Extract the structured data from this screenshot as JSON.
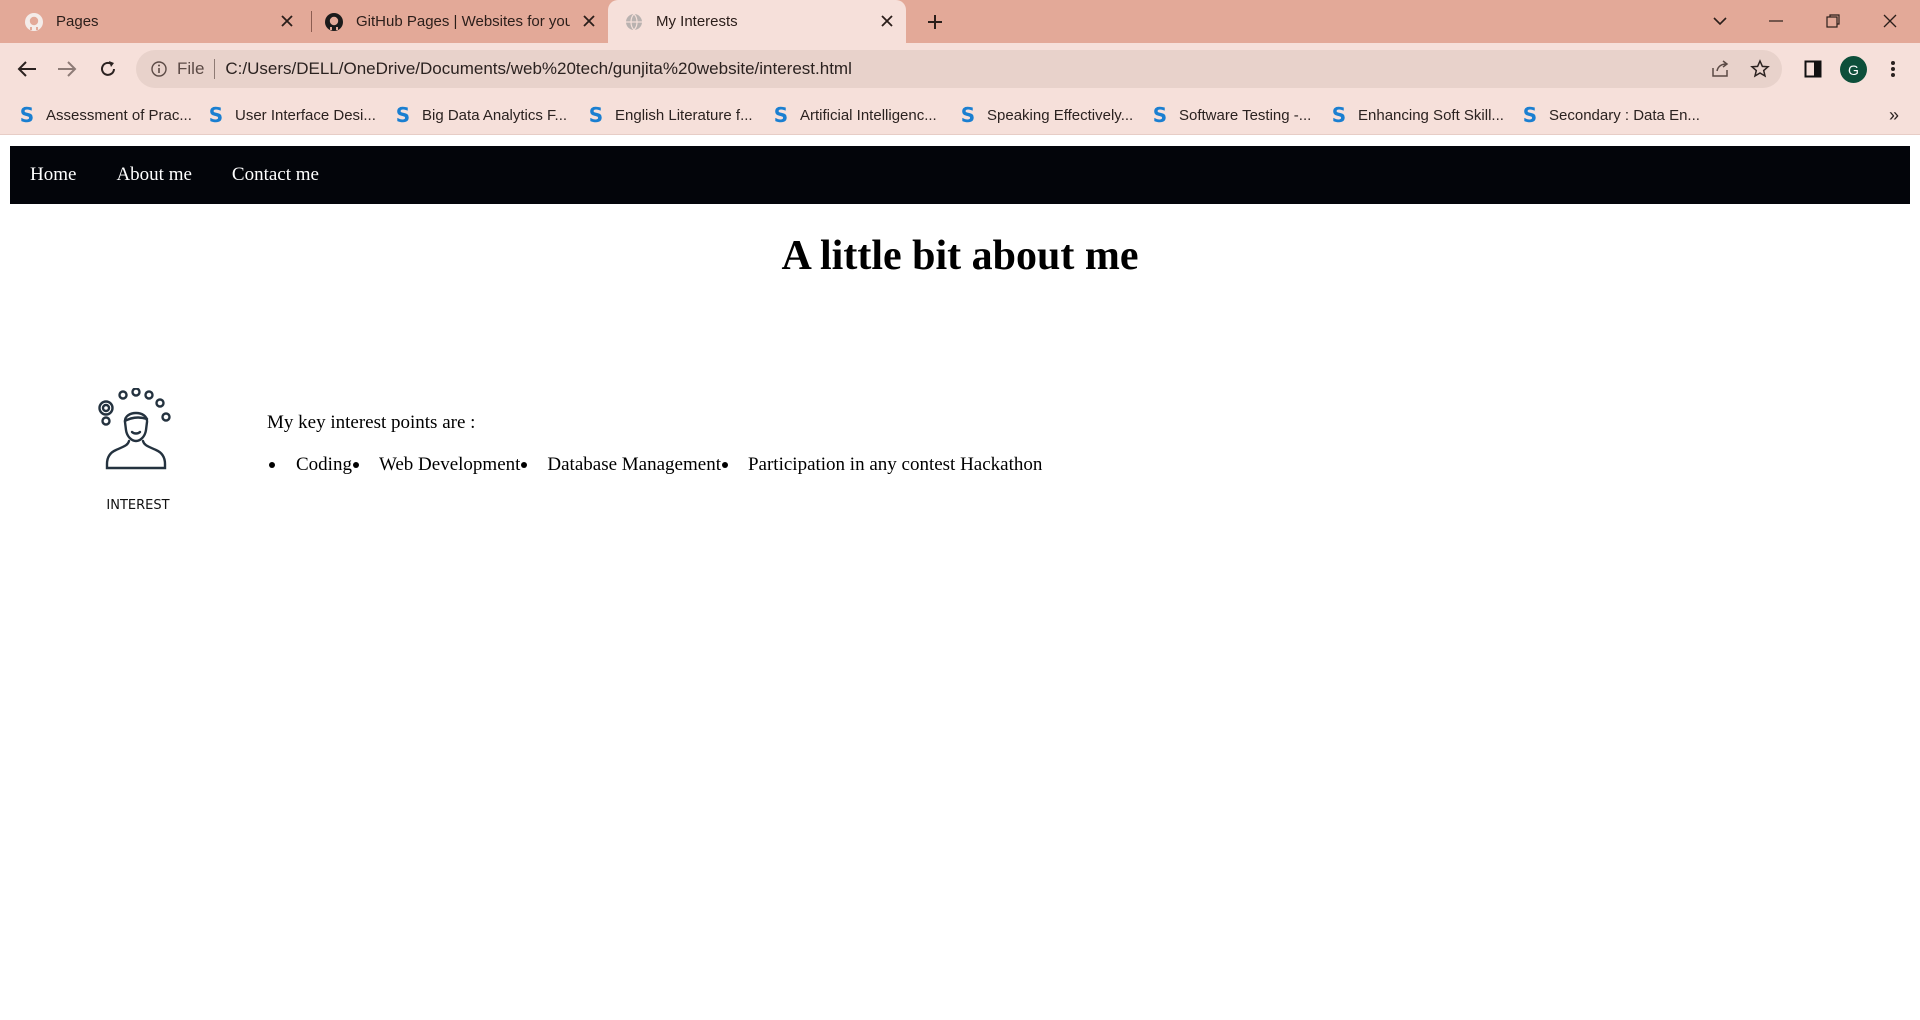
{
  "browser": {
    "tabs": [
      {
        "title": "Pages",
        "icon": "github-icon",
        "active": false
      },
      {
        "title": "GitHub Pages | Websites for you",
        "icon": "github-icon",
        "active": false
      },
      {
        "title": "My Interests",
        "icon": "globe-icon",
        "active": true
      }
    ],
    "address": {
      "scheme_label": "File",
      "url": "C:/Users/DELL/OneDrive/Documents/web%20tech/gunjita%20website/interest.html"
    },
    "profile_initial": "G",
    "bookmarks": [
      "Assessment of Prac...",
      "User Interface Desi...",
      "Big Data Analytics F...",
      "English Literature f...",
      "Artificial Intelligenc...",
      "Speaking Effectively...",
      "Software Testing -...",
      "Enhancing Soft Skill...",
      "Secondary : Data En..."
    ],
    "bookmark_icon_letter": "S",
    "more_bookmarks": "»"
  },
  "site": {
    "nav": [
      "Home",
      "About me",
      "Contact me"
    ],
    "heading": "A little bit about me",
    "card_label": "INTEREST",
    "intro": "My key interest points are :",
    "interests": [
      "Coding",
      "Web Development",
      "Database Management",
      "Participation in any contest Hackathon"
    ]
  },
  "colors": {
    "tabstrip": "#e3a998",
    "toolbar": "#f6e0da",
    "nav_bg": "#03050a",
    "bookmark_icon": "#1a7fd1",
    "avatar": "#0d4f3a"
  }
}
